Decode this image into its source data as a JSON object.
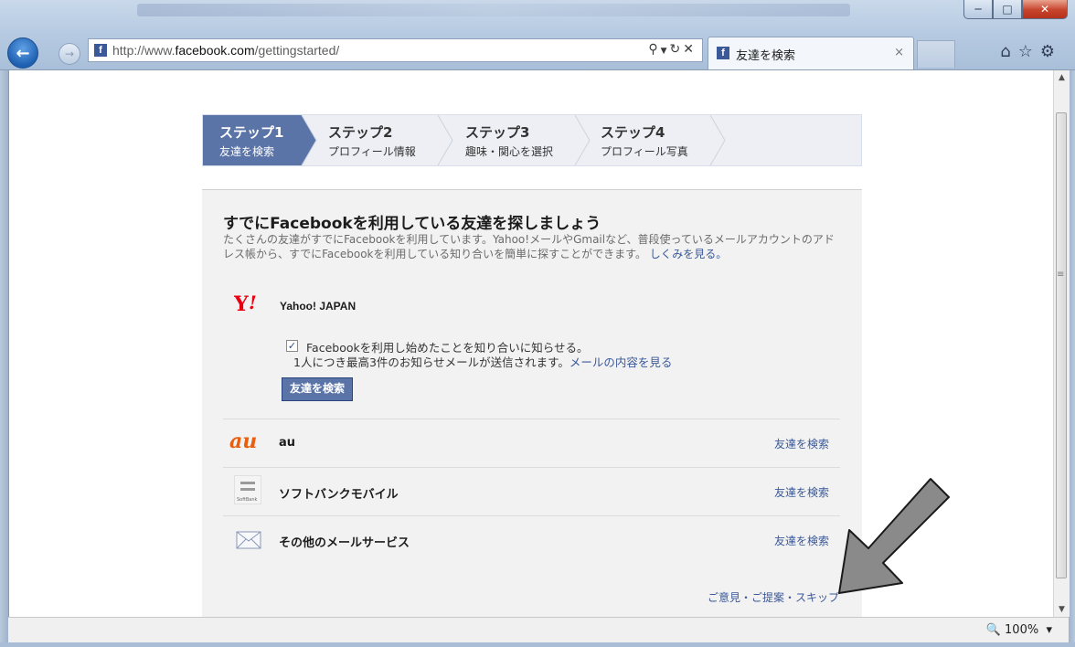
{
  "browser": {
    "url": "http://www.facebook.com/gettingstarted/",
    "url_prefix": "http://www.",
    "url_domain": "facebook.com",
    "url_path": "/gettingstarted/",
    "tab_title": "友達を検索",
    "zoom": "100%"
  },
  "steps": [
    {
      "title": "ステップ1",
      "subtitle": "友達を検索"
    },
    {
      "title": "ステップ2",
      "subtitle": "プロフィール情報"
    },
    {
      "title": "ステップ3",
      "subtitle": "趣味・関心を選択"
    },
    {
      "title": "ステップ4",
      "subtitle": "プロフィール写真"
    }
  ],
  "main": {
    "heading": "すでにFacebookを利用している友達を探しましょう",
    "description": "たくさんの友達がすでにFacebookを利用しています。Yahoo!メールやGmailなど、普段使っているメールアカウントのアドレス帳から、すでにFacebookを利用している知り合いを簡単に探すことができます。",
    "how_link": "しくみを見る。",
    "yahoo": {
      "name": "Yahoo! JAPAN",
      "checkbox_label": "Facebookを利用し始めたことを知り合いに知らせる。",
      "checkbox_checked": true,
      "checkbox_note": "1人につき最高3件のお知らせメールが送信されます。",
      "checkbox_note_link": "メールの内容を見る",
      "button": "友達を検索"
    },
    "providers": [
      {
        "name": "au",
        "logo": "au-logo",
        "action": "友達を検索"
      },
      {
        "name": "ソフトバンクモバイル",
        "logo": "softbank-logo",
        "action": "友達を検索"
      },
      {
        "name": "その他のメールサービス",
        "logo": "envelope-icon",
        "action": "友達を検索"
      }
    ],
    "footer_links": "ご意見・ご提案・スキップ"
  },
  "colors": {
    "facebook_blue": "#3b5998",
    "step_active": "#5b74a8",
    "overlay_arrow": "#7a7a7a"
  }
}
